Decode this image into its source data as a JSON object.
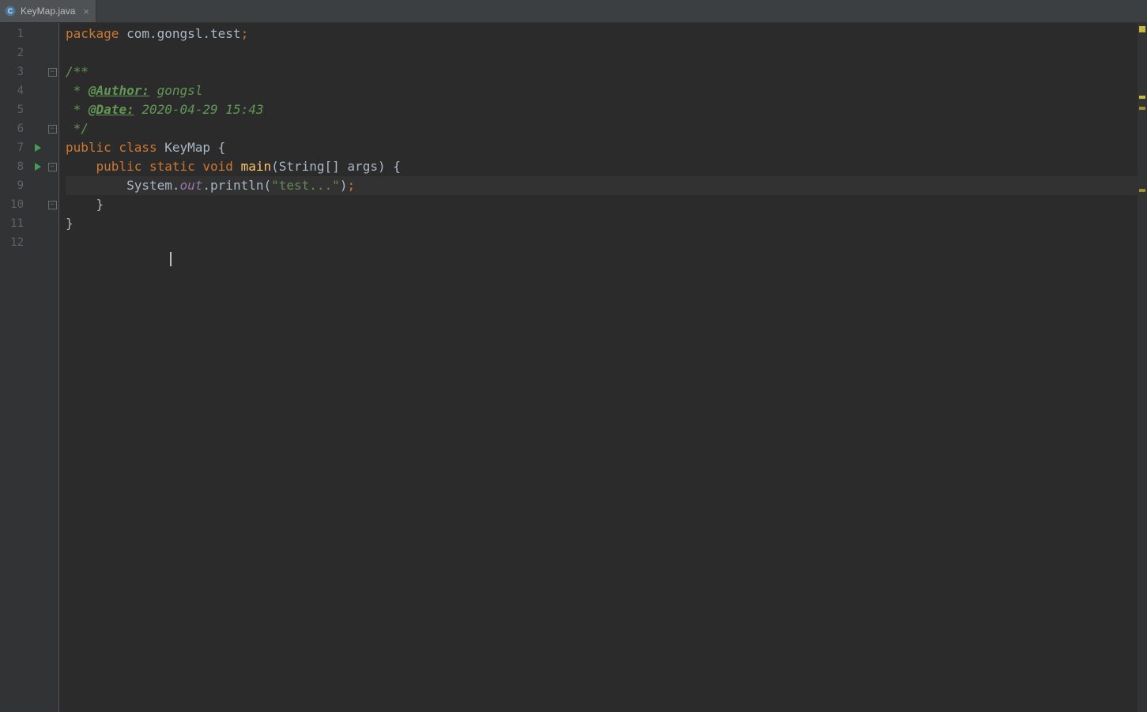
{
  "tab": {
    "filename": "KeyMap.java"
  },
  "gutter": {
    "lines": [
      "1",
      "2",
      "3",
      "4",
      "5",
      "6",
      "7",
      "8",
      "9",
      "10",
      "11",
      "12"
    ]
  },
  "code": {
    "l1_kw": "package",
    "l1_pkg": " com.gongsl.test",
    "l1_semi": ";",
    "l3_open": "/**",
    "l4_star": " * ",
    "l4_tag": "@Author:",
    "l4_rest": " gongsl",
    "l5_star": " * ",
    "l5_tag": "@Date:",
    "l5_rest": " 2020-04-29 15:43",
    "l6_close": " */",
    "l7_kw1": "public class ",
    "l7_cls": "KeyMap",
    "l7_br": " {",
    "l8_indent": "    ",
    "l8_kw": "public static void ",
    "l8_mth": "main",
    "l8_sig": "(String[] args) {",
    "l9_indent": "        ",
    "l9_sys": "System.",
    "l9_out": "out",
    "l9_call": ".println(",
    "l9_str": "\"test...\"",
    "l9_close": ")",
    "l9_semi": ";",
    "l10": "    }",
    "l11": "}"
  }
}
